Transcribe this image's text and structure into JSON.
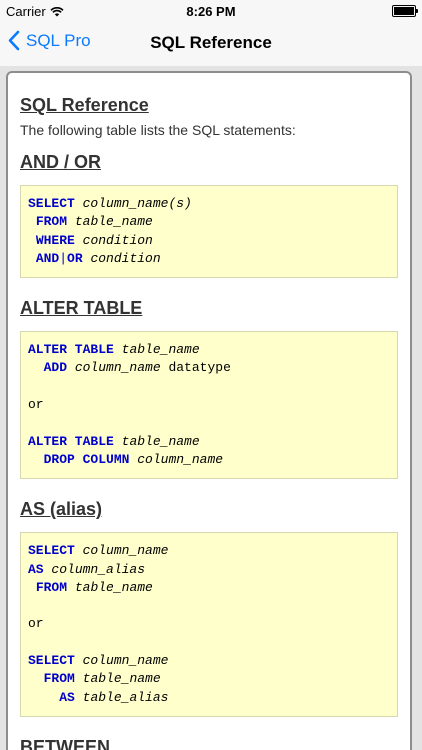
{
  "status_bar": {
    "carrier": "Carrier",
    "time": "8:26 PM"
  },
  "nav": {
    "back_label": "SQL Pro",
    "title": "SQL Reference"
  },
  "content": {
    "heading": "SQL Reference",
    "intro": "The following table lists the SQL statements:",
    "sections": [
      {
        "title": "AND / OR",
        "lines": [
          [
            {
              "t": "SELECT",
              "c": "kw"
            },
            {
              "t": " "
            },
            {
              "t": "column_name(s)",
              "c": "id"
            }
          ],
          [
            {
              "t": " "
            },
            {
              "t": "FROM",
              "c": "kw"
            },
            {
              "t": " "
            },
            {
              "t": "table_name",
              "c": "id"
            }
          ],
          [
            {
              "t": " "
            },
            {
              "t": "WHERE",
              "c": "kw"
            },
            {
              "t": " "
            },
            {
              "t": "condition",
              "c": "id"
            }
          ],
          [
            {
              "t": " "
            },
            {
              "t": "AND",
              "c": "kw"
            },
            {
              "t": "|",
              "c": "sep"
            },
            {
              "t": "OR",
              "c": "kw"
            },
            {
              "t": " "
            },
            {
              "t": "condition",
              "c": "id"
            }
          ]
        ]
      },
      {
        "title": "ALTER TABLE",
        "lines": [
          [
            {
              "t": "ALTER TABLE",
              "c": "kw"
            },
            {
              "t": " "
            },
            {
              "t": "table_name",
              "c": "id"
            }
          ],
          [
            {
              "t": "  "
            },
            {
              "t": "ADD",
              "c": "kw"
            },
            {
              "t": " "
            },
            {
              "t": "column_name",
              "c": "id"
            },
            {
              "t": " datatype"
            }
          ],
          [
            {
              "t": ""
            }
          ],
          [
            {
              "t": "or"
            }
          ],
          [
            {
              "t": ""
            }
          ],
          [
            {
              "t": "ALTER TABLE",
              "c": "kw"
            },
            {
              "t": " "
            },
            {
              "t": "table_name",
              "c": "id"
            }
          ],
          [
            {
              "t": "  "
            },
            {
              "t": "DROP COLUMN",
              "c": "kw"
            },
            {
              "t": " "
            },
            {
              "t": "column_name",
              "c": "id"
            }
          ]
        ]
      },
      {
        "title": "AS (alias)",
        "lines": [
          [
            {
              "t": "SELECT",
              "c": "kw"
            },
            {
              "t": " "
            },
            {
              "t": "column_name",
              "c": "id"
            }
          ],
          [
            {
              "t": "AS",
              "c": "kw"
            },
            {
              "t": " "
            },
            {
              "t": "column_alias",
              "c": "id"
            }
          ],
          [
            {
              "t": " "
            },
            {
              "t": "FROM",
              "c": "kw"
            },
            {
              "t": " "
            },
            {
              "t": "table_name",
              "c": "id"
            }
          ],
          [
            {
              "t": ""
            }
          ],
          [
            {
              "t": "or"
            }
          ],
          [
            {
              "t": ""
            }
          ],
          [
            {
              "t": "SELECT",
              "c": "kw"
            },
            {
              "t": " "
            },
            {
              "t": "column_name",
              "c": "id"
            }
          ],
          [
            {
              "t": "  "
            },
            {
              "t": "FROM",
              "c": "kw"
            },
            {
              "t": " "
            },
            {
              "t": "table_name",
              "c": "id"
            }
          ],
          [
            {
              "t": "    "
            },
            {
              "t": "AS",
              "c": "kw"
            },
            {
              "t": " "
            },
            {
              "t": "table_alias",
              "c": "id"
            }
          ]
        ]
      },
      {
        "title": "BETWEEN",
        "lines": []
      }
    ]
  },
  "icons": {
    "back": "chevron-left-icon",
    "wifi": "wifi-icon",
    "battery": "battery-icon"
  },
  "colors": {
    "accent": "#0a7afe",
    "keyword": "#0000cc",
    "code_bg": "#ffffcc"
  }
}
